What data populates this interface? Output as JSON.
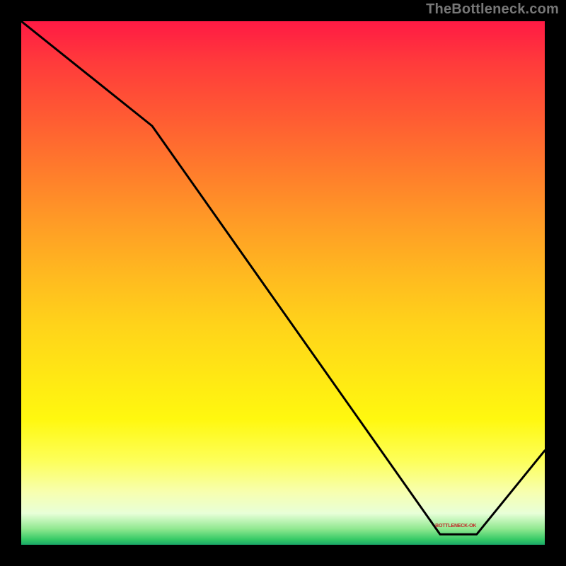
{
  "watermark": "TheBottleneck.com",
  "chart_data": {
    "type": "line",
    "title": "",
    "xlabel": "",
    "ylabel": "",
    "xlim": [
      0,
      100
    ],
    "ylim": [
      0,
      100
    ],
    "grid": false,
    "legend": false,
    "background_gradient": [
      {
        "stop": 0,
        "color": "#ff1a44"
      },
      {
        "stop": 50,
        "color": "#ffd31a"
      },
      {
        "stop": 90,
        "color": "#f7ffb0"
      },
      {
        "stop": 100,
        "color": "#1aa868"
      }
    ],
    "series": [
      {
        "name": "bottleneck-curve",
        "color": "#000000",
        "x": [
          0,
          25,
          80,
          87,
          100
        ],
        "values": [
          100,
          80,
          2,
          2,
          18
        ]
      }
    ],
    "annotations": [
      {
        "name": "dip-label",
        "text_key": "dip_label_text",
        "x": 83,
        "y": 3
      }
    ],
    "dip_label_text": "BOTTLENECK-OK"
  },
  "colors": {
    "curve_stroke": "#000000",
    "frame_background": "#000000",
    "dip_label": "#c22626",
    "watermark": "#777777"
  }
}
